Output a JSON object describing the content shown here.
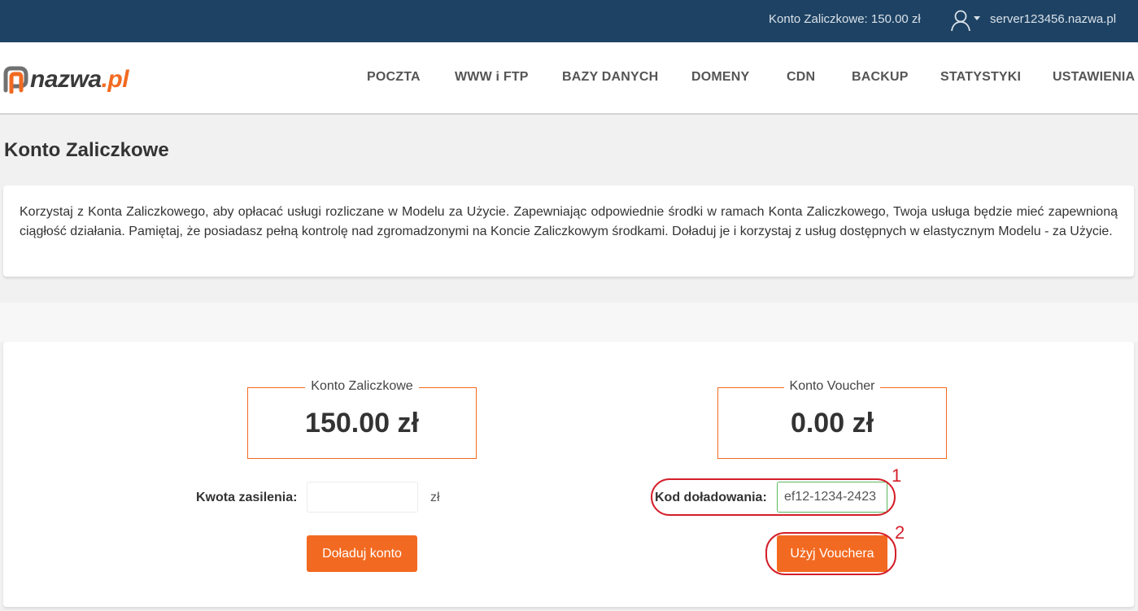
{
  "topbar": {
    "balance_text": "Konto Zaliczkowe: 150.00 zł",
    "user_icon": "user-icon",
    "server": "server123456.nazwa.pl",
    "bg_color": "#1e4263"
  },
  "logo": {
    "text_main": "nazwa",
    "text_suffix": ".pl",
    "accent_color": "#f26a21"
  },
  "nav": {
    "items": [
      {
        "label": "POCZTA"
      },
      {
        "label": "WWW i FTP"
      },
      {
        "label": "BAZY DANYCH"
      },
      {
        "label": "DOMENY"
      },
      {
        "label": "CDN"
      },
      {
        "label": "BACKUP"
      },
      {
        "label": "STATYSTYKI"
      },
      {
        "label": "USTAWIENIA"
      }
    ]
  },
  "page": {
    "title": "Konto Zaliczkowe",
    "info": "Korzystaj z Konta Zaliczkowego, aby opłacać usługi rozliczane w Modelu za Użycie. Zapewniając odpowiednie środki w ramach Konta Zaliczkowego, Twoja usługa będzie mieć zapewnioną ciągłość działania. Pamiętaj, że posiadasz pełną kontrolę nad zgromadzonymi na Koncie Zaliczkowym środkami. Doładuj je i korzystaj z usług dostępnych w elastycznym Modelu - za Użycie."
  },
  "prepaid": {
    "legend": "Konto Zaliczkowe",
    "amount": "150.00 zł",
    "topup_label": "Kwota zasilenia:",
    "topup_value": "",
    "currency": "zł",
    "button_label": "Doładuj konto"
  },
  "voucher": {
    "legend": "Konto Voucher",
    "amount": "0.00 zł",
    "code_label": "Kod doładowania:",
    "code_value": "ef12-1234-2423",
    "button_label": "Użyj Vouchera"
  },
  "annotations": {
    "one": "1",
    "two": "2",
    "color": "#d41f2a"
  }
}
